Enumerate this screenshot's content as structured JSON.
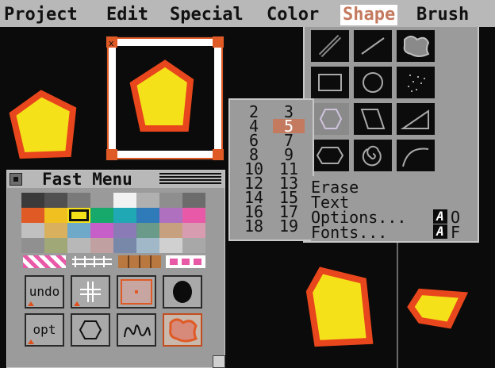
{
  "menubar": {
    "items": [
      "Project",
      "Edit",
      "Special",
      "Color",
      "Shape",
      "Brush"
    ],
    "active": "Shape"
  },
  "shape_menu": {
    "tools": [
      "pencil-icon",
      "line-icon",
      "freehand-fill-icon",
      "rectangle-icon",
      "circle-icon",
      "spray-icon",
      "hexagon-icon",
      "parallelogram-icon",
      "triangle-icon",
      "ellipse-icon",
      "spiral-icon",
      "curve-icon"
    ],
    "selected_tool": "hexagon-icon",
    "sizes": [
      "2",
      "3",
      "4",
      "5",
      "6",
      "7",
      "8",
      "9",
      "10",
      "11",
      "12",
      "13",
      "14",
      "15",
      "16",
      "17",
      "18",
      "19"
    ],
    "selected_size": "5",
    "options": [
      {
        "label": "Erase"
      },
      {
        "label": "Text"
      },
      {
        "label": "Options...",
        "shortcut": "O"
      },
      {
        "label": "Fonts...",
        "shortcut": "F"
      }
    ],
    "shortcut_modifier_glyph": "A"
  },
  "fast_menu": {
    "title": "Fast Menu",
    "palette": [
      "#3a3a3a",
      "#505050",
      "#7a7a7a",
      "#9a9a9a",
      "#f2f2f2",
      "#b0b0b0",
      "#8e8e8e",
      "#6c6c6c",
      "#e05a26",
      "#f0c020",
      "#f5e11a",
      "#17a86b",
      "#20a8b5",
      "#2f7ab8",
      "#b070c0",
      "#e85aa8",
      "#c0c0c0",
      "#d8b05e",
      "#6fa9c9",
      "#c65fc8",
      "#8a7ab5",
      "#6a9a8a",
      "#c7a080",
      "#d89cb0",
      "#909090",
      "#a0a878",
      "#b8b8b8",
      "#c0a0a0",
      "#7888a8",
      "#a0b8c8",
      "#d0d0d0",
      "#a8a8a8"
    ],
    "selected_swatch": 10,
    "tools": [
      {
        "label": "undo",
        "icon": ""
      },
      {
        "label": "",
        "icon": "grid-icon"
      },
      {
        "label": "",
        "icon": "dot-brush-icon"
      },
      {
        "label": "",
        "icon": "filled-circle-icon"
      },
      {
        "label": "opt",
        "icon": ""
      },
      {
        "label": "",
        "icon": "hexagon-icon"
      },
      {
        "label": "",
        "icon": "squiggle-icon"
      },
      {
        "label": "",
        "icon": "freehand-fill-icon"
      }
    ],
    "selected_tool_index": 7
  },
  "colors": {
    "shape_fill": "#f5e11a",
    "shape_outline": "#e8461c",
    "highlight": "#c47a5f"
  }
}
